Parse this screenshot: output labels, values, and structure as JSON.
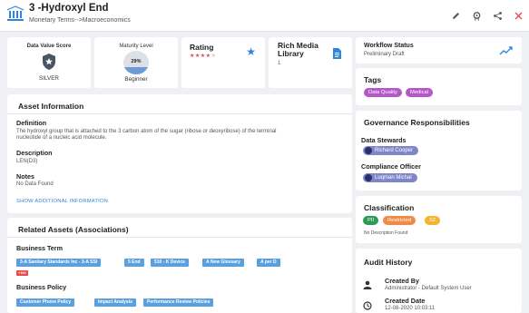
{
  "header": {
    "title": "3 -Hydroxyl End",
    "breadcrumb": "Monetary Terms-->Macroeconomics"
  },
  "summary": {
    "data_value_score": {
      "label": "Data Value Score",
      "value": "SILVER"
    },
    "maturity": {
      "label": "Maturity Level",
      "percent_text": "29%",
      "percent": 29,
      "level": "Beginner"
    },
    "rating": {
      "label": "Rating",
      "stars": 4,
      "max_stars": 5
    },
    "rich_media": {
      "label": "Rich Media Library",
      "count": "1"
    }
  },
  "workflow": {
    "label": "Workflow Status",
    "status": "Preliminary Draft"
  },
  "tags": {
    "title": "Tags",
    "items": [
      "Data Quality",
      "Medical"
    ]
  },
  "asset_info": {
    "title": "Asset Information",
    "definition_label": "Definition",
    "definition_text_line1": "The hydroxyl group that is attached to the 3 carbon atom of the sugar (ribose or deoxyribose) of the terminal",
    "definition_text_line2": "nucleotide of a nucleic acid molecule.",
    "description_label": "Description",
    "description_text": "LEN(D3)",
    "notes_label": "Notes",
    "notes_text": "No Data Found",
    "show_more": "SHOW ADDITIONAL INFORMATION"
  },
  "governance": {
    "title": "Governance Responsibilities",
    "stewards_label": "Data Stewards",
    "steward": "Richard Cooper",
    "compliance_label": "Compliance Officer",
    "officer": "Luqman Michal"
  },
  "classification": {
    "title": "Classification",
    "items": [
      "PII",
      "Restricted",
      "S2"
    ],
    "note": "No Description Found"
  },
  "related": {
    "title": "Related Assets (Associations)",
    "business_term_label": "Business Term",
    "business_terms": [
      "3-A Sanitary Standards Inc - 3-A SSI",
      "5 End",
      "510 - K Device",
      "A New Glossary",
      "A per D"
    ],
    "extra_badge": "+100",
    "business_policy_label": "Business Policy",
    "business_policies": [
      "Customer Phone Policy",
      "Impact Analysis",
      "Performance Review Policies"
    ]
  },
  "audit": {
    "title": "Audit History",
    "created_by_label": "Created By",
    "created_by": "Administrator - Default System User",
    "created_date_label": "Created Date",
    "created_date": "12-08-2020 10:03:11"
  },
  "colors": {
    "accent": "#2e86de",
    "tag": "#b457c8",
    "close": "#e84a4a"
  }
}
